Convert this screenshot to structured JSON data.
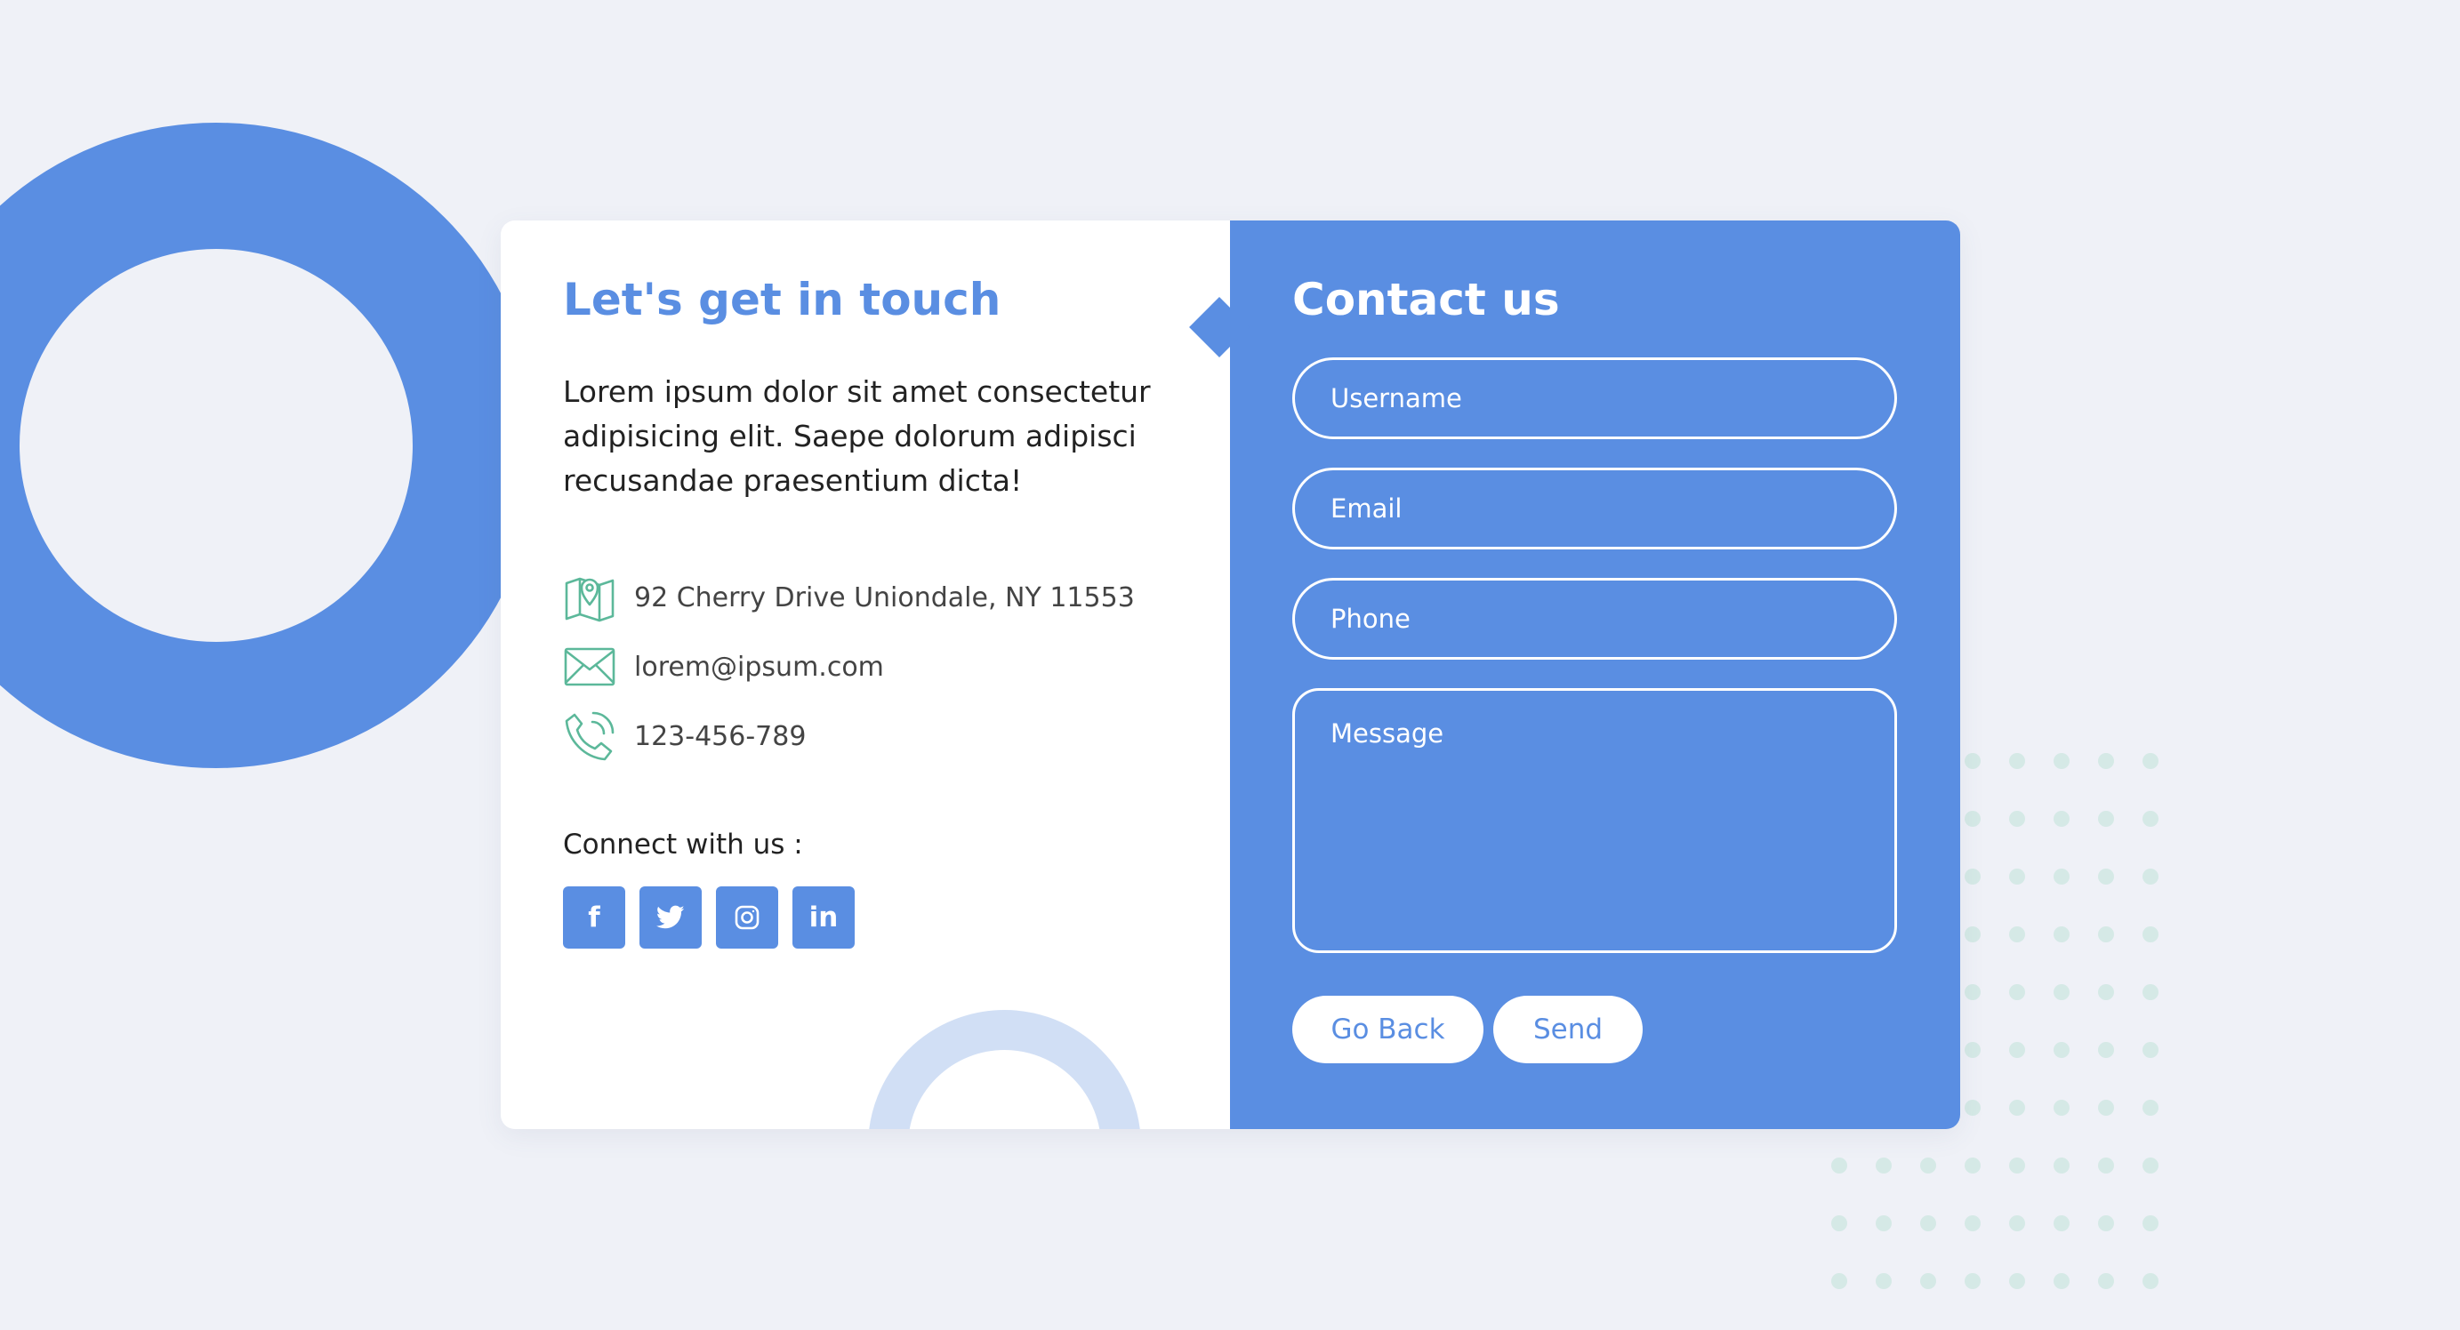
{
  "colors": {
    "accent": "#5a8ee2",
    "icon_green": "#5cb89a",
    "dots": "#d5e9e6",
    "background": "#eff1f7"
  },
  "info_panel": {
    "title": "Let's get in touch",
    "intro": "Lorem ipsum dolor sit amet consectetur adipisicing elit. Saepe dolorum adipisci recusandae praesentium dicta!",
    "address": "92 Cherry Drive Uniondale, NY 11553",
    "email": "lorem@ipsum.com",
    "phone": "123-456-789",
    "connect_label": "Connect with us :",
    "socials": [
      {
        "icon": "facebook-icon",
        "glyph": "f"
      },
      {
        "icon": "twitter-icon",
        "glyph": ""
      },
      {
        "icon": "instagram-icon",
        "glyph": ""
      },
      {
        "icon": "linkedin-icon",
        "glyph": "in"
      }
    ]
  },
  "form": {
    "title": "Contact us",
    "username_placeholder": "Username",
    "email_placeholder": "Email",
    "phone_placeholder": "Phone",
    "message_placeholder": "Message",
    "back_label": "Go Back",
    "send_label": "Send"
  }
}
